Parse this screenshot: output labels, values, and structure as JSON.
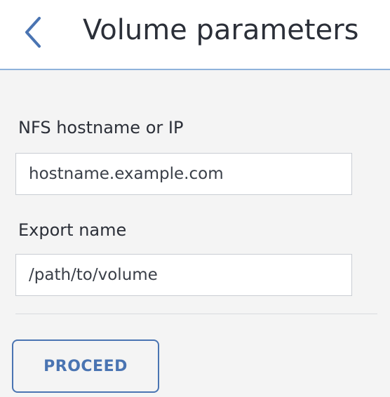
{
  "header": {
    "back_icon": "chevron-left-icon",
    "title": "Volume parameters"
  },
  "form": {
    "nfs_host": {
      "label": "NFS hostname or IP",
      "placeholder": "hostname.example.com",
      "value": ""
    },
    "export_name": {
      "label": "Export name",
      "placeholder": "/path/to/volume",
      "value": ""
    }
  },
  "actions": {
    "proceed_label": "PROCEED"
  },
  "colors": {
    "accent": "#4a74b2",
    "header_line": "#8fb2db",
    "panel_background": "#f4f4f4",
    "text": "#2b2f38"
  }
}
